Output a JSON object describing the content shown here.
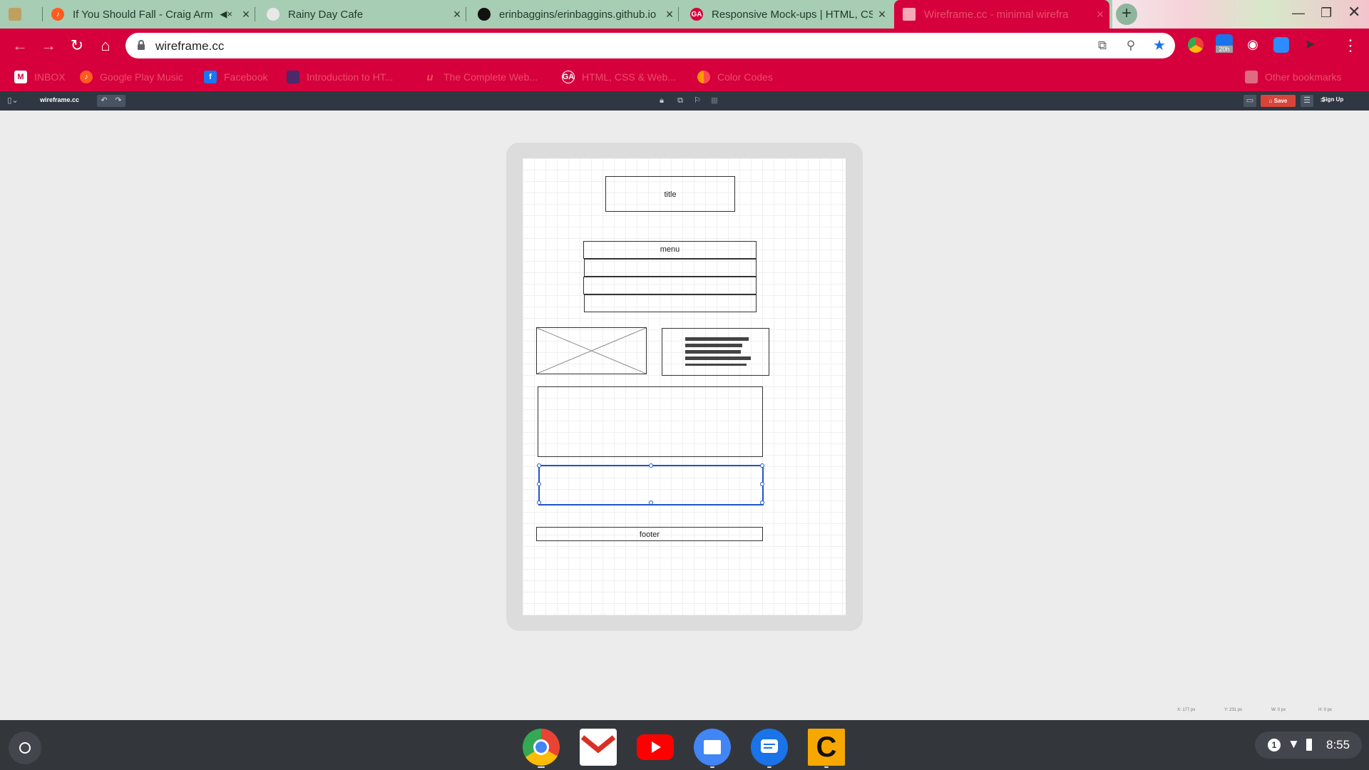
{
  "tabs": [
    {
      "label": "",
      "favicon_color": "#c0a060"
    },
    {
      "label": "If You Should Fall - Craig Arm",
      "favicon_color": "#ff5a1f",
      "muted": true
    },
    {
      "label": "Rainy Day Cafe",
      "favicon_color": "#e8e8e8"
    },
    {
      "label": "erinbaggins/erinbaggins.github.io",
      "favicon_color": "#111111"
    },
    {
      "label": "Responsive Mock-ups | HTML, CSS",
      "favicon_color": "#d6003d",
      "favicon_text": "GA"
    },
    {
      "label": "Wireframe.cc - minimal wirefra",
      "favicon_color": "#f7a9b6"
    }
  ],
  "toolbar": {
    "url": "wireframe.cc",
    "extension_badge": "20h"
  },
  "bookmarks": [
    {
      "label": "INBOX",
      "icon": "gmail-icon"
    },
    {
      "label": "Google Play Music",
      "icon": "play-music-icon"
    },
    {
      "label": "Facebook",
      "icon": "facebook-icon"
    },
    {
      "label": "Introduction to HT...",
      "icon": "course-icon"
    },
    {
      "label": "The Complete Web...",
      "icon": "udemy-icon"
    },
    {
      "label": "HTML, CSS & Web...",
      "icon": "ga-icon",
      "icon_text": "GA"
    },
    {
      "label": "Color Codes",
      "icon": "color-codes-icon"
    },
    {
      "label": "Other bookmarks",
      "icon": "folder-icon"
    }
  ],
  "appbar": {
    "brand": "wireframe.cc",
    "save_label": "Save",
    "signup_label": "Sign Up"
  },
  "wireframe": {
    "title_label": "title",
    "menu_label": "menu",
    "footer_label": "footer"
  },
  "coords": {
    "x": "X: 177 px",
    "y": "Y: 231 px",
    "w": "W: 0 px",
    "h": "H: 0 px"
  },
  "shelf": {
    "apps": [
      "chrome-icon",
      "gmail-icon",
      "youtube-icon",
      "files-icon",
      "messages-icon",
      "c-app-icon"
    ],
    "notification_count": "1",
    "time": "8:55"
  },
  "colors": {
    "tab_strip": "#a7cdb4",
    "toolbar": "#d6003d",
    "appbar": "#2f3742",
    "selection": "#1f56c9",
    "save": "#d9443a"
  }
}
